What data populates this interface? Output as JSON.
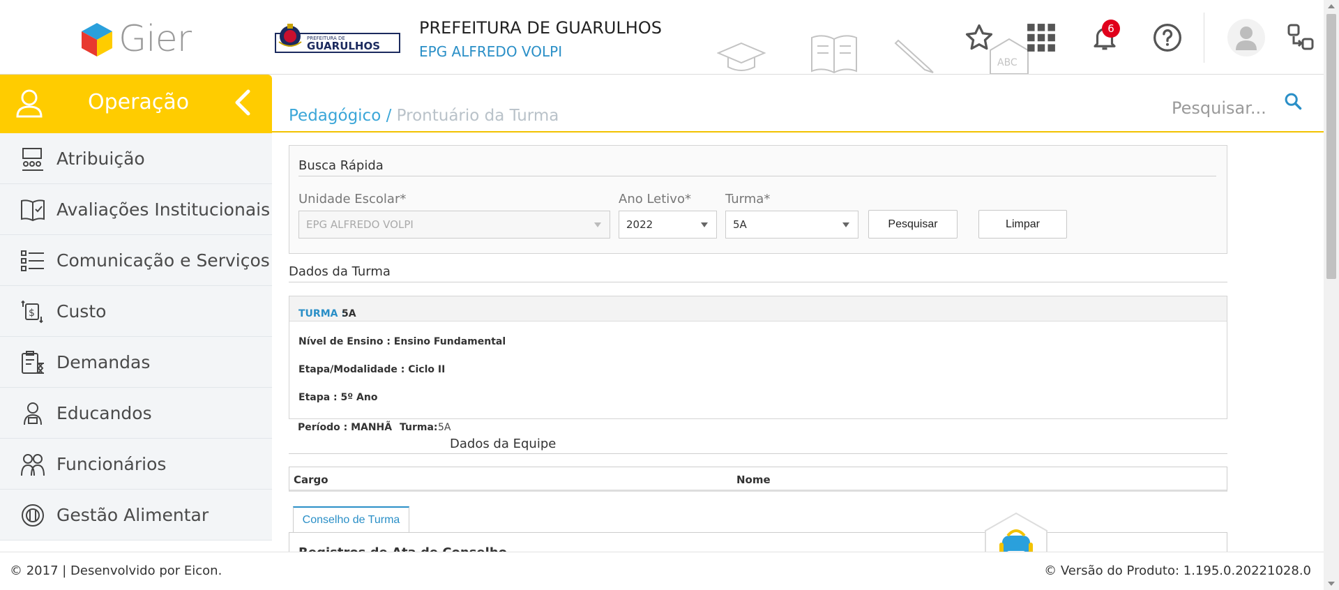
{
  "header": {
    "brand": "Gier",
    "crest_text": "GUARULHOS",
    "title": "PREFEITURA DE GUARULHOS",
    "school": "EPG ALFREDO VOLPI",
    "notifications_count": "6",
    "icons": [
      "star-icon",
      "apps-grid-icon",
      "bell-icon",
      "help-icon",
      "user-avatar",
      "switch-icon"
    ]
  },
  "sidebar": {
    "title": "Operação",
    "items": [
      {
        "label": "Atribuição",
        "icon": "classroom-icon"
      },
      {
        "label": "Avaliações Institucionais",
        "icon": "book-check-icon"
      },
      {
        "label": "Comunicação e Serviços",
        "icon": "checklist-icon"
      },
      {
        "label": "Custo",
        "icon": "money-icon"
      },
      {
        "label": "Demandas",
        "icon": "clipboard-hourglass-icon"
      },
      {
        "label": "Educandos",
        "icon": "student-icon"
      },
      {
        "label": "Funcionários",
        "icon": "staff-icon"
      },
      {
        "label": "Gestão Alimentar",
        "icon": "food-icon"
      }
    ]
  },
  "breadcrumb": {
    "parent": "Pedagógico",
    "separator": "/",
    "current": "Prontuário da Turma"
  },
  "search": {
    "placeholder": "Pesquisar..."
  },
  "quick_search": {
    "title": "Busca Rápida",
    "unidade_label": "Unidade Escolar*",
    "unidade_value": "EPG ALFREDO VOLPI",
    "ano_label": "Ano Letivo*",
    "ano_value": "2022",
    "turma_label": "Turma*",
    "turma_value": "5A",
    "search_button": "Pesquisar",
    "clear_button": "Limpar"
  },
  "dados_turma": {
    "title": "Dados da Turma",
    "turma_label": "TURMA :",
    "turma_value": "5A",
    "nivel": "Nível de Ensino : Ensino Fundamental",
    "etapa_modalidade": "Etapa/Modalidade : Ciclo II",
    "etapa": "Etapa : 5º Ano",
    "periodo": "Período : MANHÃ",
    "turma2_label": "Turma:",
    "turma2_value": "5A"
  },
  "dados_equipe": {
    "title": "Dados da Equipe",
    "col_cargo": "Cargo",
    "col_nome": "Nome"
  },
  "tabs": {
    "conselho": "Conselho de Turma",
    "registros_partial": "Registros de Ata de Conselho"
  },
  "footer": {
    "left": "© 2017 | Desenvolvido por Eicon.",
    "right": "© Versão do Produto: 1.195.0.20221028.0"
  },
  "colors": {
    "accent_yellow": "#ffcc00",
    "link_blue": "#2a8fc7",
    "badge_red": "#e0001b"
  }
}
